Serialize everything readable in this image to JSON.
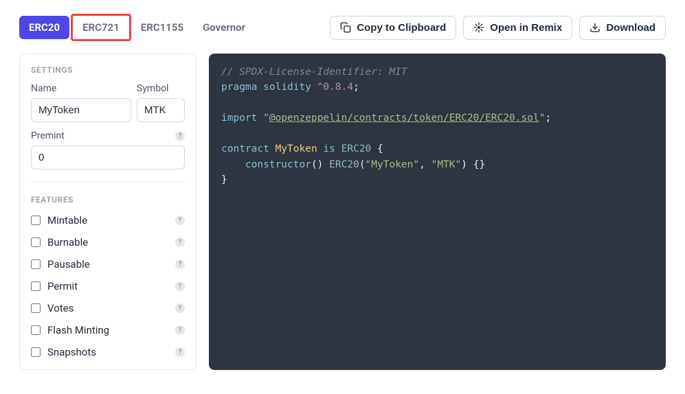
{
  "tabs": {
    "erc20": "ERC20",
    "erc721": "ERC721",
    "erc1155": "ERC1155",
    "governor": "Governor"
  },
  "actions": {
    "copy": "Copy to Clipboard",
    "remix": "Open in Remix",
    "download": "Download"
  },
  "settings": {
    "title": "SETTINGS",
    "name_label": "Name",
    "name_value": "MyToken",
    "symbol_label": "Symbol",
    "symbol_value": "MTK",
    "premint_label": "Premint",
    "premint_value": "0"
  },
  "features": {
    "title": "FEATURES",
    "items": [
      {
        "label": "Mintable"
      },
      {
        "label": "Burnable"
      },
      {
        "label": "Pausable"
      },
      {
        "label": "Permit"
      },
      {
        "label": "Votes"
      },
      {
        "label": "Flash Minting"
      },
      {
        "label": "Snapshots"
      }
    ]
  },
  "code": {
    "comment": "// SPDX-License-Identifier: MIT",
    "pragma_kw": "pragma",
    "solidity_kw": "solidity",
    "version": "^0.8.4",
    "semi": ";",
    "import_kw": "import",
    "import_path": "@openzeppelin/contracts/token/ERC20/ERC20.sol",
    "quote": "\"",
    "contract_kw": "contract",
    "contract_name": "MyToken",
    "is_kw": "is",
    "base": "ERC20",
    "open_brace": "{",
    "constructor_kw": "constructor",
    "parens": "()",
    "init_name": "ERC20",
    "arg1": "\"MyToken\"",
    "comma": ",",
    "arg2": "\"MTK\"",
    "close_paren": ")",
    "open_paren": "(",
    "empty_body": "{}",
    "close_brace": "}"
  }
}
